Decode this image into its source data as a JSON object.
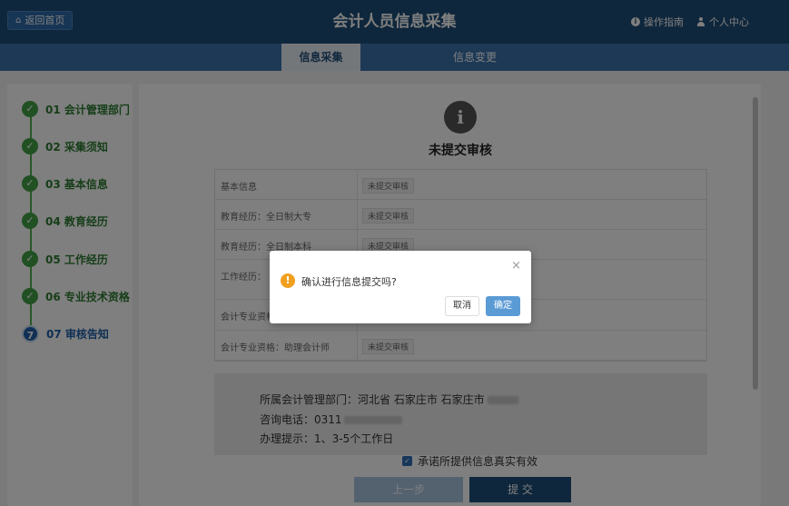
{
  "header": {
    "home_label": "返回首页",
    "title": "会计人员信息采集",
    "guide_label": "操作指南",
    "user_label": "个人中心"
  },
  "tabs": [
    {
      "label": "信息采集",
      "active": true
    },
    {
      "label": "信息变更",
      "active": false
    }
  ],
  "steps": [
    {
      "num": "✓",
      "label": "01 会计管理部门",
      "done": true
    },
    {
      "num": "✓",
      "label": "02 采集须知",
      "done": true
    },
    {
      "num": "✓",
      "label": "03 基本信息",
      "done": true
    },
    {
      "num": "✓",
      "label": "04 教育经历",
      "done": true
    },
    {
      "num": "✓",
      "label": "05 工作经历",
      "done": true
    },
    {
      "num": "✓",
      "label": "06 专业技术资格",
      "done": true
    },
    {
      "num": "7",
      "label": "07 审核告知",
      "done": false
    }
  ],
  "status": {
    "icon": "i",
    "title": "未提交审核"
  },
  "review_rows": [
    {
      "name": "基本信息",
      "status": "未提交审核"
    },
    {
      "name": "教育经历：全日制大专",
      "status": "未提交审核"
    },
    {
      "name": "教育经历：全日制本科",
      "status": "未提交审核"
    },
    {
      "name": "工作经历：",
      "status": ""
    },
    {
      "name": "会计专业资格",
      "status": ""
    },
    {
      "name": "会计专业资格：助理会计师",
      "status": "未提交审核"
    }
  ],
  "contact": {
    "dept": "所属会计管理部门：河北省 石家庄市 石家庄市",
    "phone": "咨询电话：0311",
    "tip": "办理提示：1、3-5个工作日"
  },
  "footer": {
    "agree_label": "承诺所提供信息真实有效",
    "prev_label": "上一步",
    "submit_label": "提 交"
  },
  "dialog": {
    "close": "×",
    "warn_icon": "!",
    "message": "确认进行信息提交吗?",
    "cancel_label": "取消",
    "ok_label": "确定"
  },
  "colors": {
    "header": "#1f4e79",
    "tabs_bar": "#3b73ad",
    "step_done": "#43a047",
    "step_current": "#1f5fa8",
    "warn": "#f0a020",
    "ok_button": "#5b9bd5"
  }
}
